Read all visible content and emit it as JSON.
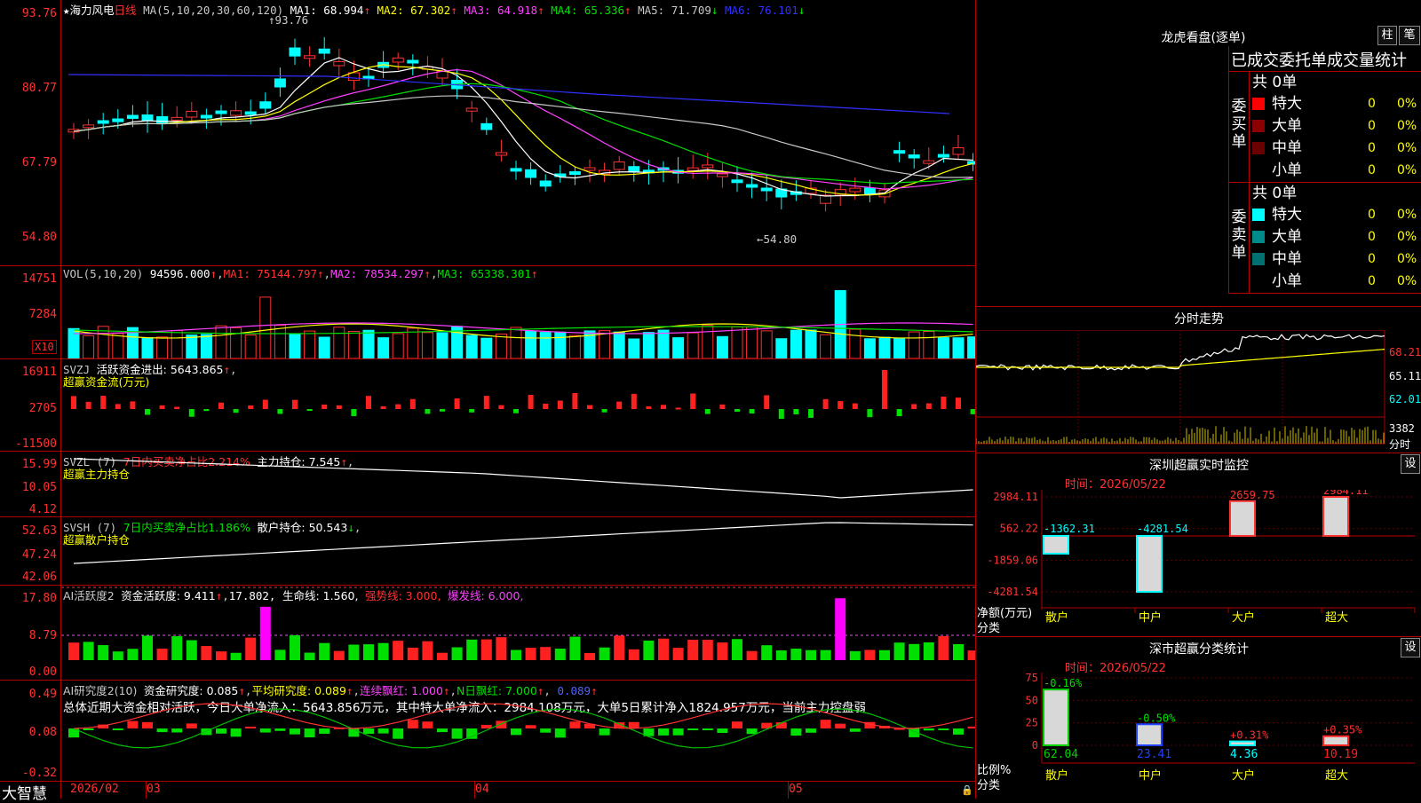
{
  "stock": {
    "name": "海力风电",
    "period": "日线",
    "star": "★"
  },
  "main_chart": {
    "indicator": "MA(5,10,20,30,60,120)",
    "ma_values": [
      {
        "label": "MA1: 68.994",
        "arrow": "↑",
        "color": "#ffffff"
      },
      {
        "label": "MA2: 67.302",
        "arrow": "↑",
        "color": "#ffff00"
      },
      {
        "label": "MA3: 64.918",
        "arrow": "↑",
        "color": "#ff40ff"
      },
      {
        "label": "MA4: 65.336",
        "arrow": "↑",
        "color": "#00e000"
      },
      {
        "label": "MA5: 71.709",
        "arrow": "↓",
        "color": "#c8c8c8"
      },
      {
        "label": "MA6: 76.101",
        "arrow": "↓",
        "color": "#3030ff"
      }
    ],
    "y_ticks": [
      "93.76",
      "80.77",
      "67.79",
      "54.80"
    ],
    "high_marker": "93.76",
    "low_marker": "54.80"
  },
  "vol_panel": {
    "title": "VOL(5,10,20)",
    "value": "94596.000",
    "ma": [
      {
        "label": "MA1: 75144.797",
        "color": "#ff3232"
      },
      {
        "label": "MA2: 78534.297",
        "color": "#ff40ff"
      },
      {
        "label": "MA3: 65338.301",
        "color": "#00e000"
      }
    ],
    "y_ticks": [
      "14751",
      "7284"
    ],
    "unit": "X10"
  },
  "svzj_panel": {
    "title": "SVZJ",
    "label": "活跃资金进出: 5643.865",
    "subtitle": "超赢资金流(万元)",
    "y_ticks": [
      "16911",
      "2705",
      "-11500"
    ]
  },
  "svzl_panel": {
    "title": "SVZL (7)",
    "ratio": "7日内买卖净占比2.214%",
    "main": "主力持仓: 7.545",
    "subtitle": "超赢主力持仓",
    "y_ticks": [
      "15.99",
      "10.05",
      "4.12"
    ]
  },
  "svsh_panel": {
    "title": "SVSH (7)",
    "ratio": "7日内买卖净占比1.186%",
    "retail": "散户持仓: 50.543",
    "subtitle": "超赢散户持仓",
    "y_ticks": [
      "52.63",
      "47.24",
      "42.06"
    ]
  },
  "ai_active_panel": {
    "title": "AI活跃度2",
    "active": "资金活跃度: 9.411",
    "v2": "17.802,",
    "life": "生命线: 1.560,",
    "strong": "强势线: 3.000,",
    "burst": "爆发线: 6.000,",
    "y_ticks": [
      "17.80",
      "8.79",
      "0.00"
    ]
  },
  "ai_research_panel": {
    "title": "AI研究度2(10)",
    "research": "资金研究度: 0.085",
    "avg": "平均研究度: 0.089",
    "cont": "连续飘红: 1.000",
    "nday": "N日飘红: 7.000",
    "last": "0.089",
    "summary": "总体近期大资金相对活跃，今日大单净流入：5643.856万元，其中特大单净流入：2984.108万元，大单5日累计净入1824.957万元，当前主力控盘弱",
    "y_ticks": [
      "0.49",
      "0.08",
      "-0.32"
    ]
  },
  "bottom_axis": {
    "brand": "大智慧",
    "labels": [
      "2026/02",
      "03",
      "04",
      "05"
    ]
  },
  "right_panel": {
    "tiger_title": "龙虎看盘(逐单)",
    "btn_zhu": "柱",
    "btn_bi": "笔",
    "stats_title": "已成交委托单成交量统计",
    "buy_group": {
      "side": "委买单",
      "total": "共 0单",
      "rows": [
        {
          "label": "特大",
          "count": "0",
          "pct": "0%",
          "color": "#ff0000"
        },
        {
          "label": "大单",
          "count": "0",
          "pct": "0%",
          "color": "#8b0000"
        },
        {
          "label": "中单",
          "count": "0",
          "pct": "0%",
          "color": "#6a0000"
        },
        {
          "label": "小单",
          "count": "0",
          "pct": "0%",
          "color": "#000000"
        }
      ]
    },
    "sell_group": {
      "side": "委卖单",
      "total": "共 0单",
      "rows": [
        {
          "label": "特大",
          "count": "0",
          "pct": "0%",
          "color": "#00ffff"
        },
        {
          "label": "大单",
          "count": "0",
          "pct": "0%",
          "color": "#008b8b"
        },
        {
          "label": "中单",
          "count": "0",
          "pct": "0%",
          "color": "#007070"
        },
        {
          "label": "小单",
          "count": "0",
          "pct": "0%",
          "color": "#000000"
        }
      ]
    },
    "intraday_title": "分时走势",
    "intraday_y": [
      "68.21",
      "65.11",
      "62.01"
    ],
    "intraday_vol": "3382",
    "intraday_vol_label": "分时",
    "monitor_title": "深圳超赢实时监控",
    "monitor_btn": "设",
    "monitor_time": "时间：2026/05/22",
    "monitor_y": [
      "2984.11",
      "562.22",
      "-1859.06",
      "-4281.54"
    ],
    "monitor_unit": "净额(万元)",
    "monitor_cat_label": "分类",
    "classify_title": "深市超赢分类统计",
    "classify_btn": "设",
    "classify_time": "时间：2026/05/22",
    "classify_y": [
      "75",
      "50",
      "25",
      "0"
    ],
    "classify_unit": "比例%",
    "classify_cat_label": "分类"
  },
  "chart_data": [
    {
      "type": "bar",
      "title": "深圳超赢实时监控",
      "ylabel": "净额(万元)",
      "categories": [
        "散户",
        "中户",
        "大户",
        "超大"
      ],
      "values": [
        -1362.31,
        -4281.54,
        2659.75,
        2984.11
      ],
      "value_labels": [
        "-1362.31",
        "-4281.54",
        "2659.75",
        "2984.11"
      ],
      "ylim": [
        -4281.54,
        2984.11
      ]
    },
    {
      "type": "bar",
      "title": "深市超赢分类统计",
      "ylabel": "比例%",
      "categories": [
        "散户",
        "中户",
        "大户",
        "超大"
      ],
      "values": [
        62.04,
        23.41,
        4.36,
        10.19
      ],
      "value_labels": [
        "62.04",
        "23.41",
        "4.36",
        "10.19"
      ],
      "change_labels": [
        "-0.16%",
        "-0.50%",
        "+0.31%",
        "+0.35%"
      ],
      "bar_colors": [
        "#00d000",
        "#2040ff",
        "#00ffff",
        "#ff2020"
      ],
      "ylim": [
        0,
        75
      ]
    }
  ]
}
